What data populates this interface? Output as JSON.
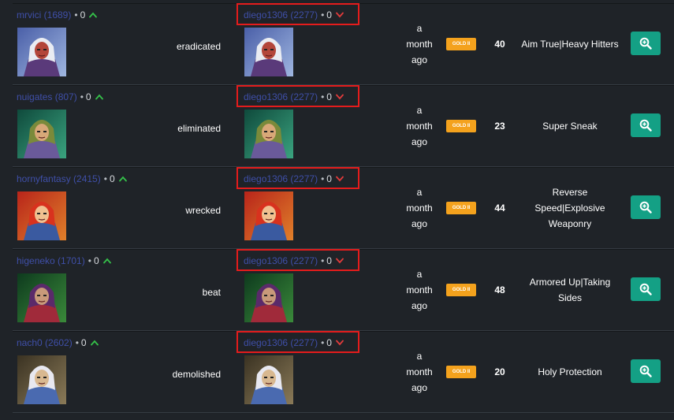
{
  "colors": {
    "background": "#1f2328",
    "player_link": "#3f4fa8",
    "up_arrow": "#35c24a",
    "down_arrow": "#e23b3b",
    "badge": "#f4a21d",
    "zoom_button": "#14a085",
    "highlight_box": "#e41c1c"
  },
  "rows": [
    {
      "attacker": {
        "name": "mrvici (1689)",
        "dot": "•",
        "score": "0",
        "arrow": "up",
        "avatar": "white-haired-warrior-portrait"
      },
      "verb": "eradicated",
      "defender": {
        "name": "diego1306 (2277)",
        "dot": "•",
        "score": "0",
        "arrow": "down",
        "avatar": "white-haired-warrior-portrait"
      },
      "time": [
        "a",
        "month",
        "ago"
      ],
      "badge": "GOLD II",
      "level": "40",
      "perks": [
        "Aim True|Heavy Hitters"
      ]
    },
    {
      "attacker": {
        "name": "nuigates (807)",
        "dot": "•",
        "score": "0",
        "arrow": "up",
        "avatar": "green-haired-elf-portrait"
      },
      "verb": "eliminated",
      "defender": {
        "name": "diego1306 (2277)",
        "dot": "•",
        "score": "0",
        "arrow": "down",
        "avatar": "green-haired-elf-portrait"
      },
      "time": [
        "a",
        "month",
        "ago"
      ],
      "badge": "GOLD II",
      "level": "23",
      "perks": [
        "Super Sneak"
      ]
    },
    {
      "attacker": {
        "name": "hornyfantasy (2415)",
        "dot": "•",
        "score": "0",
        "arrow": "up",
        "avatar": "red-haired-fighter-portrait"
      },
      "verb": "wrecked",
      "defender": {
        "name": "diego1306 (2277)",
        "dot": "•",
        "score": "0",
        "arrow": "down",
        "avatar": "red-haired-fighter-portrait"
      },
      "time": [
        "a",
        "month",
        "ago"
      ],
      "badge": "GOLD II",
      "level": "44",
      "perks": [
        "Reverse",
        "Speed|Explosive",
        "Weaponry"
      ]
    },
    {
      "attacker": {
        "name": "higeneko (1701)",
        "dot": "•",
        "score": "0",
        "arrow": "up",
        "avatar": "purple-haired-sorceress-portrait"
      },
      "verb": "beat",
      "defender": {
        "name": "diego1306 (2277)",
        "dot": "•",
        "score": "0",
        "arrow": "down",
        "avatar": "purple-haired-sorceress-portrait"
      },
      "time": [
        "a",
        "month",
        "ago"
      ],
      "badge": "GOLD II",
      "level": "48",
      "perks": [
        "Armored Up|Taking",
        "Sides"
      ]
    },
    {
      "attacker": {
        "name": "nach0 (2602)",
        "dot": "•",
        "score": "0",
        "arrow": "up",
        "avatar": "white-bearded-wizard-portrait"
      },
      "verb": "demolished",
      "defender": {
        "name": "diego1306 (2277)",
        "dot": "•",
        "score": "0",
        "arrow": "down",
        "avatar": "white-bearded-wizard-portrait"
      },
      "time": [
        "a",
        "month",
        "ago"
      ],
      "badge": "GOLD II",
      "level": "20",
      "perks": [
        "Holy Protection"
      ]
    }
  ]
}
